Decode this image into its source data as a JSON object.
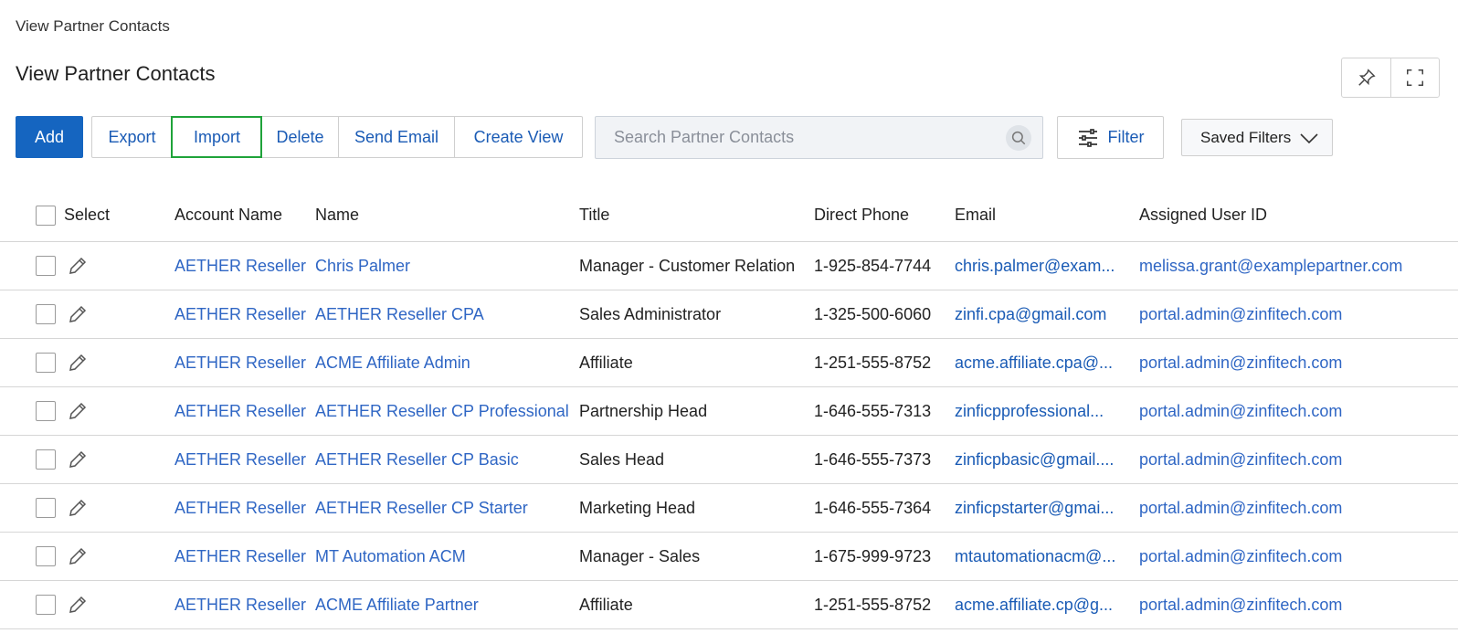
{
  "breadcrumb": "View Partner Contacts",
  "page_title": "View Partner Contacts",
  "top_actions": {
    "pin_icon": "pin-icon",
    "expand_icon": "fullscreen-icon"
  },
  "toolbar": {
    "add_label": "Add",
    "buttons": [
      {
        "label": "Export"
      },
      {
        "label": "Import"
      },
      {
        "label": "Delete"
      },
      {
        "label": "Send Email"
      },
      {
        "label": "Create View"
      }
    ]
  },
  "search": {
    "placeholder": "Search Partner Contacts",
    "icon": "search-icon"
  },
  "filter": {
    "label": "Filter",
    "icon": "sliders-icon"
  },
  "saved_filters": {
    "label": "Saved Filters",
    "icon": "chevron-down-icon"
  },
  "table": {
    "columns": [
      "Select",
      "Account Name",
      "Name",
      "Title",
      "Direct Phone",
      "Email",
      "Assigned User ID"
    ],
    "rows": [
      {
        "account": "AETHER Reseller",
        "name": "Chris Palmer",
        "title": "Manager - Customer Relation",
        "phone": "1-925-854-7744",
        "email": "chris.palmer@exam...",
        "user": "melissa.grant@examplepartner.com"
      },
      {
        "account": "AETHER Reseller",
        "name": "AETHER Reseller CPA",
        "title": "Sales Administrator",
        "phone": "1-325-500-6060",
        "email": "zinfi.cpa@gmail.com",
        "user": "portal.admin@zinfitech.com"
      },
      {
        "account": "AETHER Reseller",
        "name": "ACME Affiliate Admin",
        "title": "Affiliate",
        "phone": "1-251-555-8752",
        "email": "acme.affiliate.cpa@...",
        "user": "portal.admin@zinfitech.com"
      },
      {
        "account": "AETHER Reseller",
        "name": "AETHER Reseller CP Professional",
        "title": "Partnership Head",
        "phone": "1-646-555-7313",
        "email": "zinficpprofessional...",
        "user": "portal.admin@zinfitech.com"
      },
      {
        "account": "AETHER Reseller",
        "name": "AETHER Reseller CP Basic",
        "title": "Sales Head",
        "phone": "1-646-555-7373",
        "email": "zinficpbasic@gmail....",
        "user": "portal.admin@zinfitech.com"
      },
      {
        "account": "AETHER Reseller",
        "name": "AETHER Reseller CP Starter",
        "title": "Marketing Head",
        "phone": "1-646-555-7364",
        "email": "zinficpstarter@gmai...",
        "user": "portal.admin@zinfitech.com"
      },
      {
        "account": "AETHER Reseller",
        "name": "MT Automation ACM",
        "title": "Manager - Sales",
        "phone": "1-675-999-9723",
        "email": "mtautomationacm@...",
        "user": "portal.admin@zinfitech.com"
      },
      {
        "account": "AETHER Reseller",
        "name": "ACME Affiliate Partner",
        "title": "Affiliate",
        "phone": "1-251-555-8752",
        "email": "acme.affiliate.cp@g...",
        "user": "portal.admin@zinfitech.com"
      }
    ]
  },
  "colors": {
    "primary": "#1565c0",
    "link": "#2f66c4",
    "highlight": "#1fa33a"
  }
}
